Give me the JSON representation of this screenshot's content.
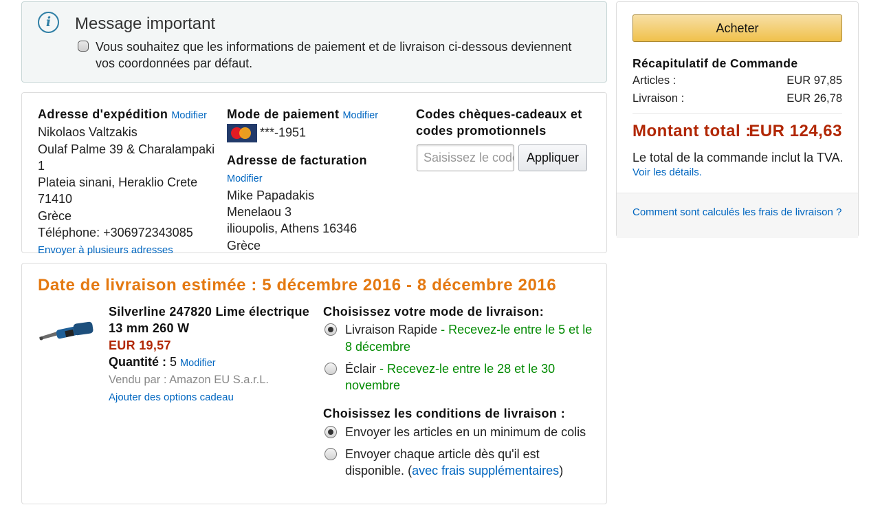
{
  "message": {
    "title": "Message important",
    "checkbox_text": "Vous souhaitez que les informations de paiement et de livraison ci-dessous deviennent vos coordonnées par défaut."
  },
  "shipping": {
    "heading": "Adresse d'expédition",
    "modify": "Modifier",
    "lines": [
      "Nikolaos Valtzakis",
      "Oulaf Palme 39 & Charalampaki 1",
      "Plateia sinani, Heraklio Crete",
      "71410",
      "Grèce",
      "Téléphone: +306972343085"
    ],
    "multi_link": "Envoyer à plusieurs adresses"
  },
  "payment": {
    "heading": "Mode de paiement",
    "modify": "Modifier",
    "card_icon": "mastercard-icon",
    "card_number": "***-1951"
  },
  "billing": {
    "heading": "Adresse de facturation",
    "modify": "Modifier",
    "lines": [
      "Mike Papadakis",
      "Menelaou 3",
      "ilioupolis, Athens 16346",
      "Grèce"
    ]
  },
  "codes": {
    "heading": "Codes chèques-cadeaux et codes promotionnels",
    "placeholder": "Saisissez le code",
    "apply": "Appliquer"
  },
  "delivery": {
    "date_label": "Date de livraison estimée :  5 décembre 2016 - 8 décembre 2016",
    "item": {
      "name": "Silverline 247820 Lime électrique 13 mm 260 W",
      "price": "EUR 19,57",
      "quantity_label": "Quantité :",
      "quantity": "5",
      "modify": "Modifier",
      "seller": "Vendu par : Amazon EU S.a.r.L.",
      "gift_link": "Ajouter des options cadeau"
    },
    "mode_heading": "Choisissez votre mode de livraison:",
    "modes": [
      {
        "label": "Livraison Rapide",
        "detail": "- Recevez-le entre le 5 et le 8 décembre",
        "selected": true
      },
      {
        "label": "Éclair",
        "detail": "- Recevez-le entre le 28 et le 30 novembre",
        "selected": false
      }
    ],
    "conditions_heading": "Choisissez les conditions de livraison :",
    "conditions": [
      {
        "label": "Envoyer les articles en un minimum de colis",
        "selected": true
      },
      {
        "label": "Envoyer chaque article dès qu'il est disponible.",
        "paren_open": "(",
        "link": "avec frais supplémentaires",
        "paren_close": ")",
        "selected": false
      }
    ]
  },
  "summary": {
    "buy": "Acheter",
    "title": "Récapitulatif de Commande",
    "articles_label": "Articles :",
    "articles_value": "EUR 97,85",
    "shipping_label": "Livraison :",
    "shipping_value": "EUR 26,78",
    "total_label": "Montant total :",
    "total_value": "EUR 124,63",
    "tva_text": "Le total de la commande inclut la TVA.",
    "details_link": "Voir les détails.",
    "how_link": "Comment sont calculés les frais de livraison ?"
  },
  "colors": {
    "accent_orange": "#e47911",
    "price_red": "#b12704",
    "link_blue": "#0066c0",
    "delivery_green": "#008a00",
    "buy_button": "#f0c14b"
  }
}
